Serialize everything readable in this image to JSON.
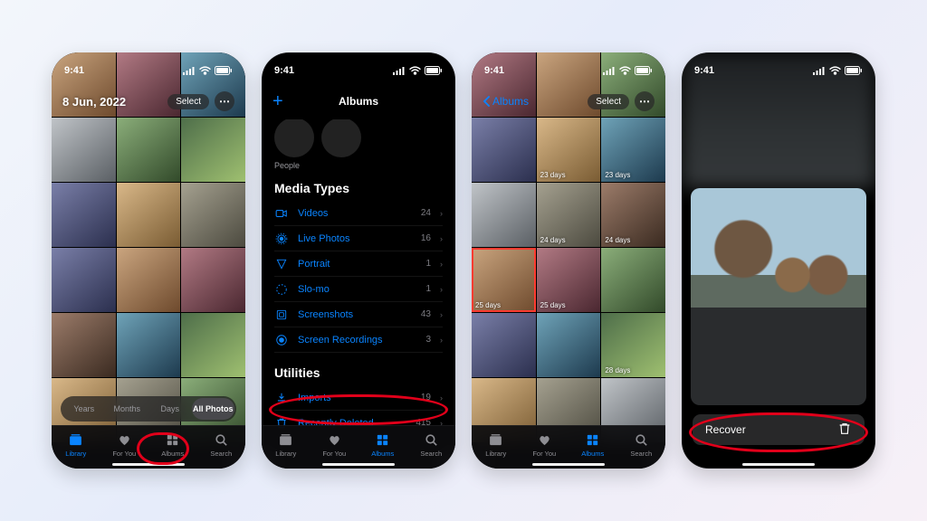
{
  "status": {
    "time": "9:41"
  },
  "seg": [
    "Years",
    "Months",
    "Days",
    "All Photos"
  ],
  "tabs": [
    "Library",
    "For You",
    "Albums",
    "Search"
  ],
  "p1": {
    "date_overlay": "8 Jun, 2022",
    "select_label": "Select",
    "active_tab": 0,
    "active_seg": 3
  },
  "p2": {
    "title": "Albums",
    "people_label": "People",
    "sections": {
      "media_types": {
        "title": "Media Types",
        "items": [
          {
            "icon": "video",
            "label": "Videos",
            "count": "24"
          },
          {
            "icon": "live",
            "label": "Live Photos",
            "count": "16"
          },
          {
            "icon": "portrait",
            "label": "Portrait",
            "count": "1"
          },
          {
            "icon": "slomo",
            "label": "Slo-mo",
            "count": "1"
          },
          {
            "icon": "screenshot",
            "label": "Screenshots",
            "count": "43"
          },
          {
            "icon": "recording",
            "label": "Screen Recordings",
            "count": "3"
          }
        ]
      },
      "utilities": {
        "title": "Utilities",
        "items": [
          {
            "icon": "imports",
            "label": "Imports",
            "count": "19"
          },
          {
            "icon": "trash",
            "label": "Recently Deleted",
            "count": "415"
          }
        ]
      }
    },
    "active_tab": 2
  },
  "p3": {
    "back_label": "Albums",
    "select_label": "Select",
    "active_tab": 2,
    "day_tags": [
      "23 days",
      "23 days",
      "24 days",
      "24 days",
      "25 days",
      "25 days",
      "28 days"
    ]
  },
  "p4": {
    "recover_label": "Recover"
  }
}
